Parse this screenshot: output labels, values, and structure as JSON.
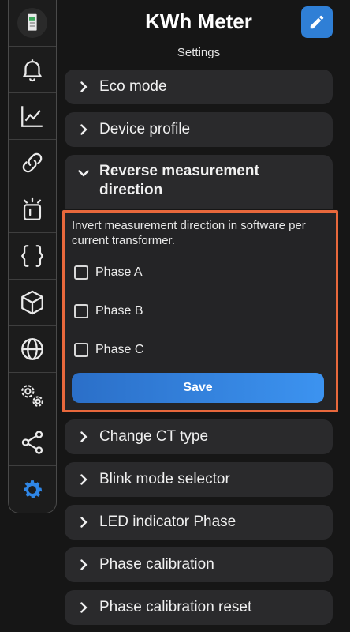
{
  "header": {
    "title": "KWh Meter",
    "subtitle": "Settings",
    "edit_icon": "pencil-icon"
  },
  "sidebar": {
    "items": [
      {
        "icon": "device-thumbnail"
      },
      {
        "icon": "bell-icon"
      },
      {
        "icon": "chart-line-icon"
      },
      {
        "icon": "link-icon"
      },
      {
        "icon": "alarm-light-icon"
      },
      {
        "icon": "code-braces-icon"
      },
      {
        "icon": "cube-icon"
      },
      {
        "icon": "globe-icon"
      },
      {
        "icon": "cogs-icon"
      },
      {
        "icon": "share-icon"
      },
      {
        "icon": "gear-icon",
        "active": true
      }
    ],
    "active_color": "#2f86e6"
  },
  "sections": [
    {
      "label": "Eco mode"
    },
    {
      "label": "Device profile"
    },
    {
      "label": "Reverse measurement direction",
      "expanded": true
    },
    {
      "label": "Change CT type"
    },
    {
      "label": "Blink mode selector"
    },
    {
      "label": "LED indicator Phase"
    },
    {
      "label": "Phase calibration"
    },
    {
      "label": "Phase calibration reset"
    }
  ],
  "reverse_panel": {
    "description": "Invert measurement direction in software per current transformer.",
    "options": [
      {
        "label": "Phase A",
        "checked": false
      },
      {
        "label": "Phase B",
        "checked": false
      },
      {
        "label": "Phase C",
        "checked": false
      }
    ],
    "save_label": "Save"
  },
  "colors": {
    "highlight_border": "#e8683c",
    "accent": "#2f7fd6"
  }
}
